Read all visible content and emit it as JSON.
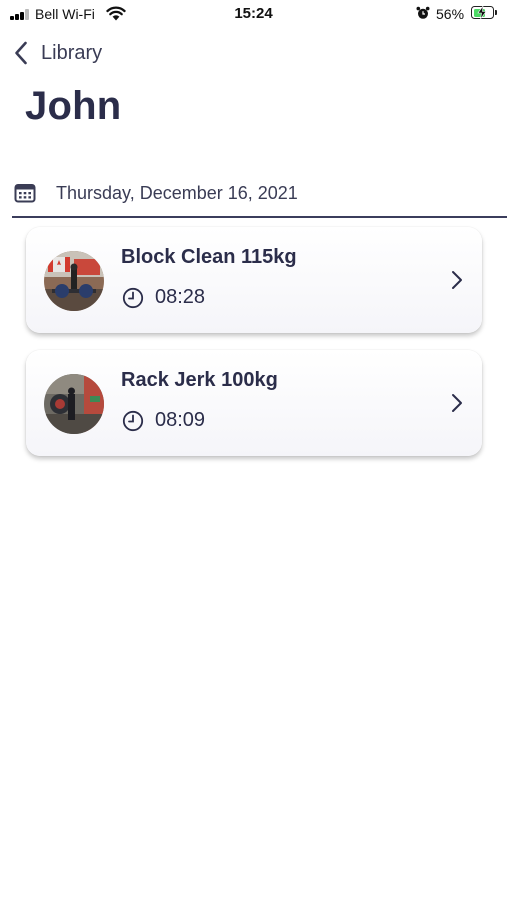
{
  "status_bar": {
    "carrier": "Bell Wi-Fi",
    "time": "15:24",
    "battery_percent": "56%",
    "icons": [
      "signal-icon",
      "wifi-icon",
      "alarm-icon",
      "battery-charging-icon"
    ]
  },
  "nav": {
    "back_label": "Library",
    "back_icon": "chevron-left-icon"
  },
  "page": {
    "title": "John"
  },
  "date_section": {
    "icon": "calendar-icon",
    "date": "Thursday, December 16, 2021"
  },
  "sessions": [
    {
      "title": "Block Clean 115kg",
      "time": "08:28",
      "icon": "clock-icon",
      "chevron": "chevron-right-icon"
    },
    {
      "title": "Rack Jerk 100kg",
      "time": "08:09",
      "icon": "clock-icon",
      "chevron": "chevron-right-icon"
    }
  ],
  "colors": {
    "text_primary": "#2b2d4a",
    "divider": "#3b3d5c",
    "battery_fill": "#4cd964",
    "background": "#ffffff"
  }
}
